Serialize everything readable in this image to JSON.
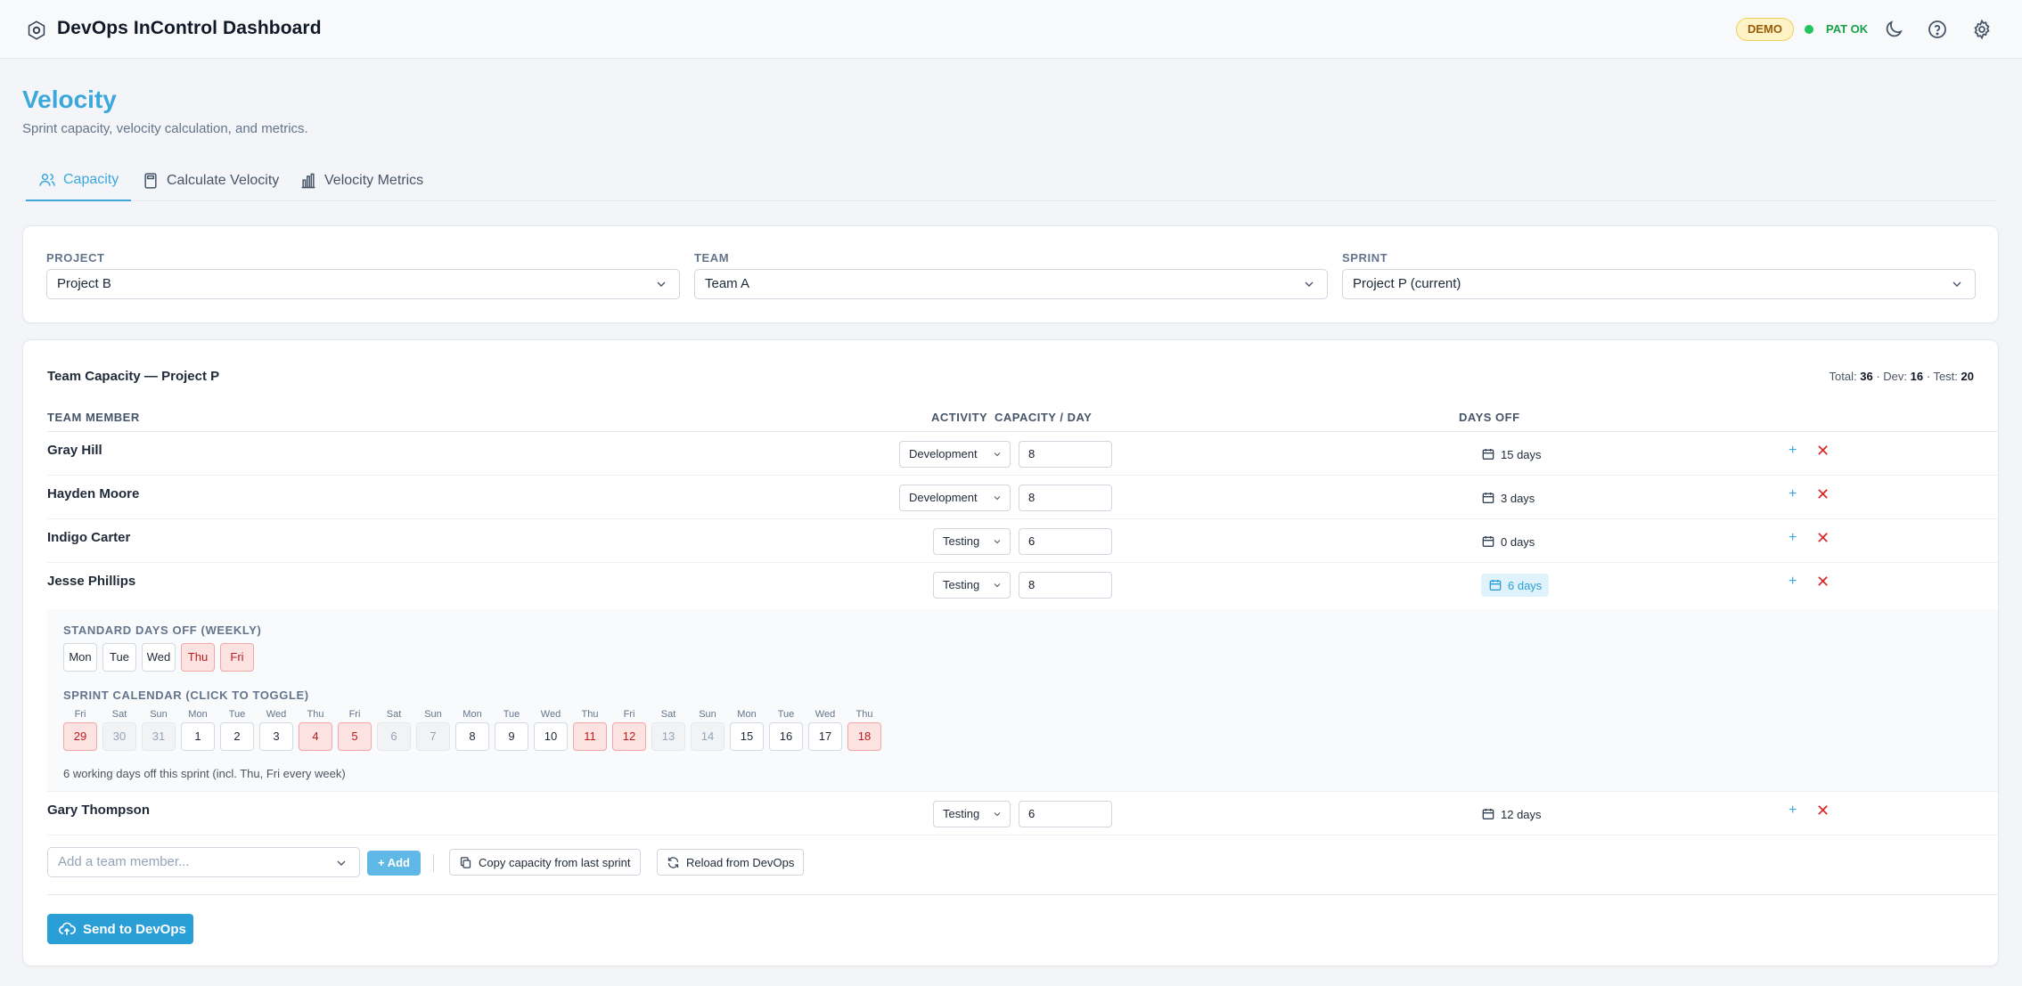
{
  "app": {
    "title": "DevOps InControl Dashboard",
    "demo_badge": "DEMO",
    "pat_status": "PAT OK"
  },
  "page": {
    "title": "Velocity",
    "subtitle": "Sprint capacity, velocity calculation, and metrics."
  },
  "tabs": [
    {
      "label": "Capacity",
      "icon": "users-icon",
      "active": true
    },
    {
      "label": "Calculate Velocity",
      "icon": "calculator-icon",
      "active": false
    },
    {
      "label": "Velocity Metrics",
      "icon": "bar-chart-icon",
      "active": false
    }
  ],
  "filters": {
    "project": {
      "label": "PROJECT",
      "value": "Project B"
    },
    "team": {
      "label": "TEAM",
      "value": "Team A"
    },
    "sprint": {
      "label": "SPRINT",
      "value": "Project P (current)"
    }
  },
  "capacity": {
    "title": "Team Capacity — Project P",
    "totals": {
      "total_label": "Total:",
      "total": "36",
      "dev_label": "· Dev:",
      "dev": "16",
      "test_label": "· Test:",
      "test": "20"
    },
    "headers": {
      "member": "TEAM MEMBER",
      "activity": "ACTIVITY",
      "capacity": "CAPACITY / DAY",
      "days_off": "DAYS OFF"
    },
    "members": [
      {
        "name": "Gray Hill",
        "activity": "Development",
        "capacity": "8",
        "days_off": "15 days"
      },
      {
        "name": "Hayden Moore",
        "activity": "Development",
        "capacity": "8",
        "days_off": "3 days"
      },
      {
        "name": "Indigo Carter",
        "activity": "Testing",
        "capacity": "6",
        "days_off": "0 days"
      },
      {
        "name": "Jesse Phillips",
        "activity": "Testing",
        "capacity": "8",
        "days_off": "6 days"
      },
      {
        "name": "Gary Thompson",
        "activity": "Testing",
        "capacity": "6",
        "days_off": "12 days"
      }
    ],
    "add_symbol": "+",
    "remove_symbol": "✕",
    "expanded": {
      "weekly_label": "STANDARD DAYS OFF (WEEKLY)",
      "weekdays": [
        {
          "label": "Mon",
          "off": false
        },
        {
          "label": "Tue",
          "off": false
        },
        {
          "label": "Wed",
          "off": false
        },
        {
          "label": "Thu",
          "off": true
        },
        {
          "label": "Fri",
          "off": true
        }
      ],
      "calendar_label": "SPRINT CALENDAR (CLICK TO TOGGLE)",
      "calendar": [
        {
          "dow": "Fri",
          "day": "29",
          "state": "off"
        },
        {
          "dow": "Sat",
          "day": "30",
          "state": "weekend"
        },
        {
          "dow": "Sun",
          "day": "31",
          "state": "weekend"
        },
        {
          "dow": "Mon",
          "day": "1",
          "state": "on"
        },
        {
          "dow": "Tue",
          "day": "2",
          "state": "on"
        },
        {
          "dow": "Wed",
          "day": "3",
          "state": "on"
        },
        {
          "dow": "Thu",
          "day": "4",
          "state": "off"
        },
        {
          "dow": "Fri",
          "day": "5",
          "state": "off"
        },
        {
          "dow": "Sat",
          "day": "6",
          "state": "weekend"
        },
        {
          "dow": "Sun",
          "day": "7",
          "state": "weekend"
        },
        {
          "dow": "Mon",
          "day": "8",
          "state": "on"
        },
        {
          "dow": "Tue",
          "day": "9",
          "state": "on"
        },
        {
          "dow": "Wed",
          "day": "10",
          "state": "on"
        },
        {
          "dow": "Thu",
          "day": "11",
          "state": "off"
        },
        {
          "dow": "Fri",
          "day": "12",
          "state": "off"
        },
        {
          "dow": "Sat",
          "day": "13",
          "state": "weekend"
        },
        {
          "dow": "Sun",
          "day": "14",
          "state": "weekend"
        },
        {
          "dow": "Mon",
          "day": "15",
          "state": "on"
        },
        {
          "dow": "Tue",
          "day": "16",
          "state": "on"
        },
        {
          "dow": "Wed",
          "day": "17",
          "state": "on"
        },
        {
          "dow": "Thu",
          "day": "18",
          "state": "off"
        }
      ],
      "note": "6 working days off this sprint  (incl. Thu, Fri every week)"
    },
    "add_member_placeholder": "Add a team member...",
    "add_button": "+ Add",
    "copy_button": "Copy capacity from last sprint",
    "reload_button": "Reload from DevOps",
    "send_button": "Send to DevOps"
  },
  "colors": {
    "accent": "#3ba7db",
    "danger": "#dc2626",
    "off_bg": "#fde2e2",
    "ok": "#22c55e"
  }
}
